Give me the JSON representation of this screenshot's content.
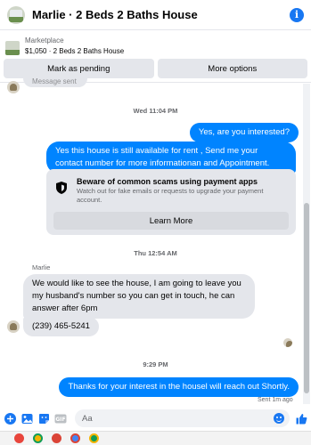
{
  "header": {
    "title": "Marlie · 2 Beds 2 Baths House",
    "info_icon": "info-icon"
  },
  "marketplace": {
    "label": "Marketplace",
    "listing": "$1,050 · 2 Beds 2 Baths House"
  },
  "actions": {
    "mark_pending": "Mark as pending",
    "more_options": "More options"
  },
  "partial_message": "Message sent",
  "timestamps": {
    "t1": "Wed 11:04 PM",
    "t2": "Thu 12:54 AM",
    "t3": "9:29 PM"
  },
  "messages": {
    "out_1": "Yes, are you interested?",
    "out_2": "Yes this house is still available for rent , Send me your contact number for more informationan and Appointment.",
    "in_name": "Marlie",
    "in_1": "We would like to see the house, I am going to leave you my husband's number so you can get in touch, he can answer after 6pm",
    "in_2": "(239) 465-5241",
    "out_3": "Thanks for your interest in the housel will reach out Shortly."
  },
  "safety_card": {
    "title": "Beware of common scams using payment apps",
    "desc": "Watch out for fake emails or requests to upgrade your payment account.",
    "button": "Learn More"
  },
  "status": {
    "sent": "Sent 1m ago"
  },
  "composer": {
    "placeholder": "Aa"
  },
  "colors": {
    "accent": "#0084ff",
    "bubble_in": "#e4e6eb",
    "brand": "#1877f2"
  }
}
